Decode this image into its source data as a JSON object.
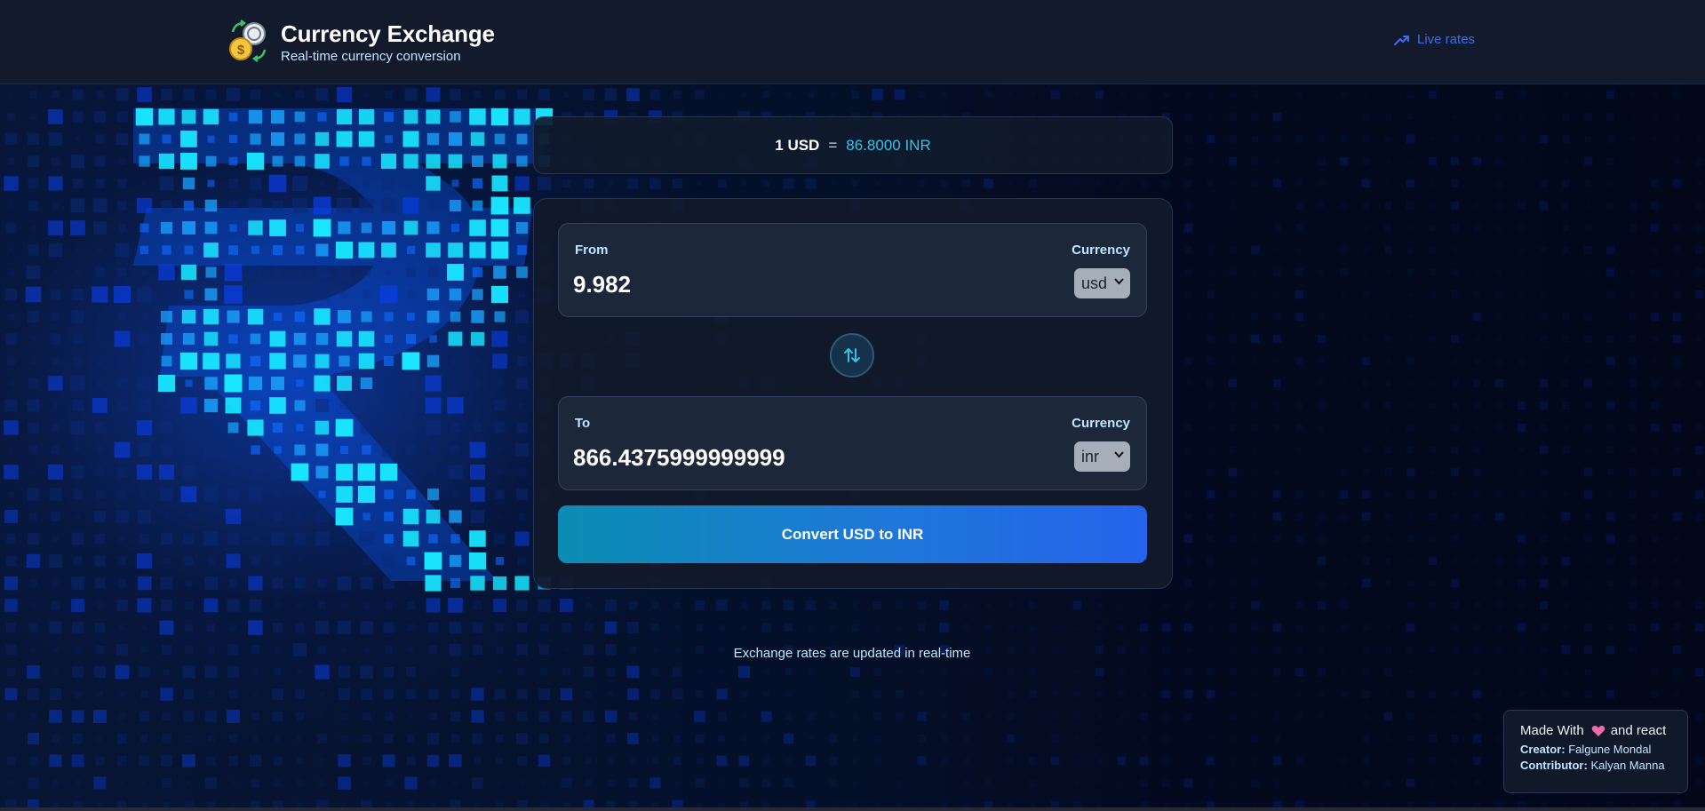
{
  "header": {
    "title": "Currency Exchange",
    "subtitle": "Real-time currency conversion",
    "live_rates_label": "Live rates",
    "logo_icon": "currency-exchange-coins-icon",
    "live_rates_icon": "trending-up-icon"
  },
  "rate": {
    "base": "1 USD",
    "equals": "=",
    "target": "86.8000 INR"
  },
  "converter": {
    "from": {
      "label": "From",
      "currency_label": "Currency",
      "amount": "9.982",
      "currency": "usd"
    },
    "to": {
      "label": "To",
      "currency_label": "Currency",
      "amount": "866.4375999999999",
      "currency": "inr"
    },
    "swap_icon": "swap-arrows-icon",
    "convert_label": "Convert USD to INR"
  },
  "note": "Exchange rates are updated in real-time",
  "credits": {
    "made_with": "Made With",
    "and_react": "and react",
    "creator_label": "Creator:",
    "creator": "Falgune Mondal",
    "contributor_label": "Contributor:",
    "contributor": "Kalyan Manna",
    "heart_icon": "heart-icon"
  },
  "colors": {
    "accent_cyan": "#31c4e8",
    "link_blue": "#3b6df0",
    "button_start": "#0b8db3",
    "button_end": "#2563eb",
    "page_bg": "#030a1f"
  }
}
